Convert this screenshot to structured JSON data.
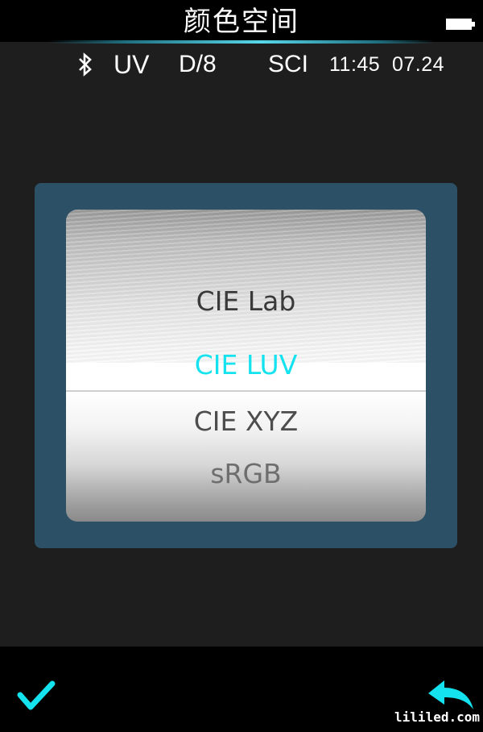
{
  "header": {
    "title": "颜色空间",
    "battery_icon": "battery-full-icon"
  },
  "status": {
    "bluetooth_icon": "bluetooth-icon",
    "light_source": "UV",
    "geometry": "D/8",
    "mode": "SCI",
    "time": "11:45",
    "date": "07.24"
  },
  "picker": {
    "selected_index": 1,
    "options": [
      {
        "label": "CIE Lab"
      },
      {
        "label": "CIE LUV"
      },
      {
        "label": "CIE XYZ"
      },
      {
        "label": "sRGB"
      }
    ],
    "selected_color": "#14e3ef"
  },
  "footer": {
    "confirm_icon": "checkmark-icon",
    "back_icon": "back-arrow-icon",
    "accent_color": "#14e3ef"
  },
  "watermark": "lililed.com"
}
